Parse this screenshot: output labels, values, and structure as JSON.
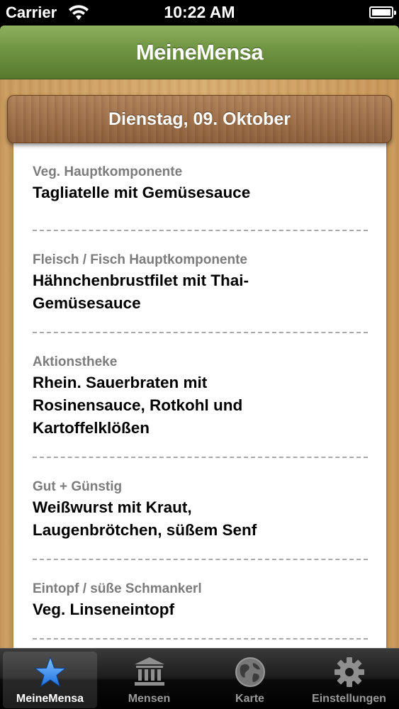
{
  "status_bar": {
    "carrier": "Carrier",
    "time": "10:22 AM"
  },
  "nav_bar": {
    "title": "MeineMensa"
  },
  "date_header": "Dienstag, 09. Oktober",
  "menu": [
    {
      "category": "Veg. Hauptkomponente",
      "dish": "Tagliatelle mit Gemüsesauce"
    },
    {
      "category": "Fleisch / Fisch Hauptkomponente",
      "dish": "Hähnchenbrustfilet mit Thai-Gemüsesauce"
    },
    {
      "category": "Aktionstheke",
      "dish": "Rhein. Sauerbraten mit Rosinensauce, Rotkohl und Kartoffelklößen"
    },
    {
      "category": "Gut + Günstig",
      "dish": "Weißwurst mit Kraut, Laugenbrötchen, süßem Senf"
    },
    {
      "category": "Eintopf / süße Schmankerl",
      "dish": "Veg. Linseneintopf"
    }
  ],
  "tab_bar": {
    "tabs": [
      {
        "label": "MeineMensa",
        "icon": "star-icon",
        "selected": true
      },
      {
        "label": "Mensen",
        "icon": "building-icon",
        "selected": false
      },
      {
        "label": "Karte",
        "icon": "globe-icon",
        "selected": false
      },
      {
        "label": "Einstellungen",
        "icon": "gear-icon",
        "selected": false
      }
    ]
  },
  "colors": {
    "nav_green": "#6f9442",
    "wood": "#d8ad70",
    "category_gray": "#7c7c7c",
    "tab_selected_blue": "#3a8ff0"
  }
}
